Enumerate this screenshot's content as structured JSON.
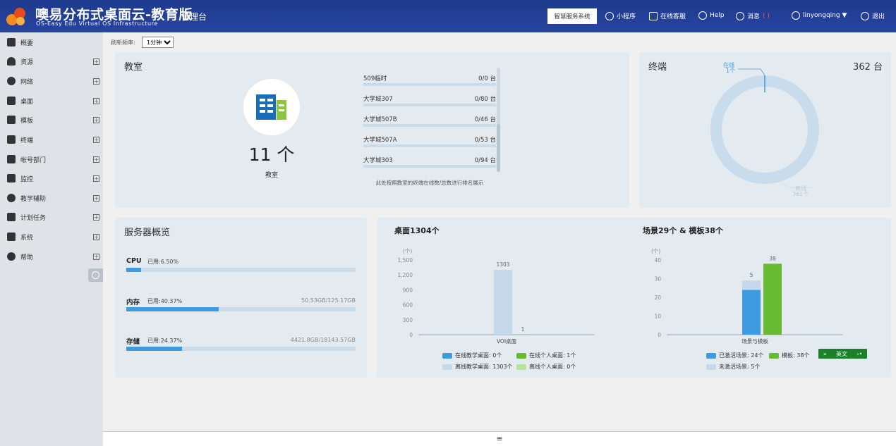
{
  "header": {
    "title": "噢易分布式桌面云-教育版",
    "console": "管理台",
    "subtitle": "OS-Easy Edu Virtual OS Infrastructure",
    "smart_service_label": "智慧服务系统",
    "mini_program_label": "小程序",
    "online_service_label": "在线客服",
    "help_label": "Help",
    "messages_label": "消息",
    "messages_count": "( )",
    "user_label": "linyongqing ▼",
    "logout_label": "退出",
    "colors": {
      "header_bg": "#1e3a8f",
      "message_count": "#ff5252"
    }
  },
  "sidebar": {
    "items": [
      {
        "label": "概要",
        "icon": "home-icon"
      },
      {
        "label": "资源",
        "icon": "cloud-icon"
      },
      {
        "label": "网络",
        "icon": "globe-icon"
      },
      {
        "label": "桌面",
        "icon": "monitor-icon"
      },
      {
        "label": "模板",
        "icon": "template-icon"
      },
      {
        "label": "终端",
        "icon": "terminal-icon"
      },
      {
        "label": "帐号部门",
        "icon": "users-icon"
      },
      {
        "label": "监控",
        "icon": "monitor-chart-icon"
      },
      {
        "label": "教学辅助",
        "icon": "clock-icon"
      },
      {
        "label": "计划任务",
        "icon": "calendar-icon"
      },
      {
        "label": "系统",
        "icon": "gears-icon"
      },
      {
        "label": "帮助",
        "icon": "help-icon"
      }
    ]
  },
  "refresh": {
    "label": "刷新频率:",
    "value": "1分钟"
  },
  "classroom": {
    "title": "教室",
    "count": "11 个",
    "label": "教室",
    "rooms": [
      {
        "name": "509临时",
        "value": "0/0 台"
      },
      {
        "name": "大学城307",
        "value": "0/80 台"
      },
      {
        "name": "大学城507B",
        "value": "0/46 台"
      },
      {
        "name": "大学城507A",
        "value": "0/53 台"
      },
      {
        "name": "大学城303",
        "value": "0/94 台"
      }
    ],
    "note": "此处按照教室的终端在线数/总数进行排名展示"
  },
  "terminal": {
    "title": "终端",
    "total": "362 台",
    "online_label": "在线",
    "online_value": "1个",
    "offline_label": "离线",
    "offline_value": "361个"
  },
  "server": {
    "title": "服务器概览",
    "cpu": {
      "label": "CPU",
      "used": "已用:6.50%",
      "capacity": "",
      "percent": 6.5
    },
    "mem": {
      "label": "内存",
      "used": "已用:40.37%",
      "capacity": "50.53GB/125.17GB",
      "percent": 40.37
    },
    "storage": {
      "label": "存储",
      "used": "已用:24.37%",
      "capacity": "4421.8GB/18143.57GB",
      "percent": 24.37
    }
  },
  "chart_data": [
    {
      "type": "bar",
      "title": "桌面1304个",
      "ylabel": "(个)",
      "xlabel": "VOI桌面",
      "categories": [
        "VOI桌面"
      ],
      "ylim": [
        0,
        1500
      ],
      "yticks": [
        "0",
        "300",
        "600",
        "900",
        "1,200",
        "1,500"
      ],
      "series": [
        {
          "name": "在线教学桌面: 0个",
          "values": [
            0
          ],
          "color": "#3f9be0"
        },
        {
          "name": "离线教学桌面: 1303个",
          "values": [
            1303
          ],
          "color": "#c6d9ea"
        },
        {
          "name": "在线个人桌面: 1个",
          "values": [
            1
          ],
          "color": "#66bb33"
        },
        {
          "name": "离线个人桌面: 0个",
          "values": [
            0
          ],
          "color": "#b5e39b"
        }
      ],
      "data_labels": [
        "1303",
        "1"
      ]
    },
    {
      "type": "bar",
      "title": "场景29个 & 模板38个",
      "ylabel": "(个)",
      "xlabel": "场景与模板",
      "categories": [
        "场景与模板"
      ],
      "ylim": [
        0,
        40
      ],
      "yticks": [
        "0",
        "10",
        "20",
        "30",
        "40"
      ],
      "series": [
        {
          "name": "已激活场景: 24个",
          "values": [
            24
          ],
          "color": "#3f9be0"
        },
        {
          "name": "未激活场景: 5个",
          "values": [
            5
          ],
          "color": "#c6d9ea"
        },
        {
          "name": "模板: 38个",
          "values": [
            38
          ],
          "color": "#66bb33"
        }
      ],
      "data_labels": [
        "5",
        "38"
      ]
    },
    {
      "type": "pie",
      "title": "终端",
      "categories": [
        "在线",
        "离线"
      ],
      "values": [
        1,
        361
      ],
      "colors": [
        "#3f9be0",
        "#c8dcec"
      ]
    }
  ],
  "lang_widget": {
    "label": "英文"
  },
  "bottom": {
    "handle": "≡"
  }
}
